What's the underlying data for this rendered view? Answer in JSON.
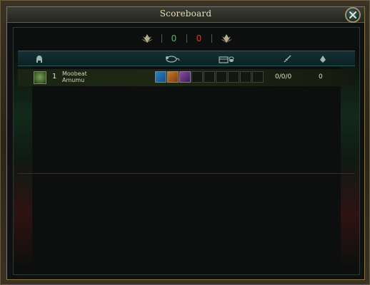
{
  "window": {
    "title": "Scoreboard"
  },
  "score": {
    "blue": "0",
    "red": "0"
  },
  "colors": {
    "blue_team": "#46c25a",
    "red_team": "#d23a2a",
    "gold_frame": "#8a7344"
  },
  "columns": [
    {
      "icon": "helmet-icon"
    },
    {
      "icon": "rat-icon"
    },
    {
      "icon": "chest-icon"
    },
    {
      "icon": "sword-icon"
    },
    {
      "icon": "gem-icon"
    }
  ],
  "players": [
    {
      "level": "1",
      "summoner": "Moobeat",
      "champion": "Amumu",
      "items": [
        "blue-sigil-item",
        "orange-staff-item",
        "purple-orb-item",
        "",
        "",
        "",
        "",
        "",
        ""
      ],
      "kda": "0/0/0",
      "cs": "0"
    }
  ]
}
